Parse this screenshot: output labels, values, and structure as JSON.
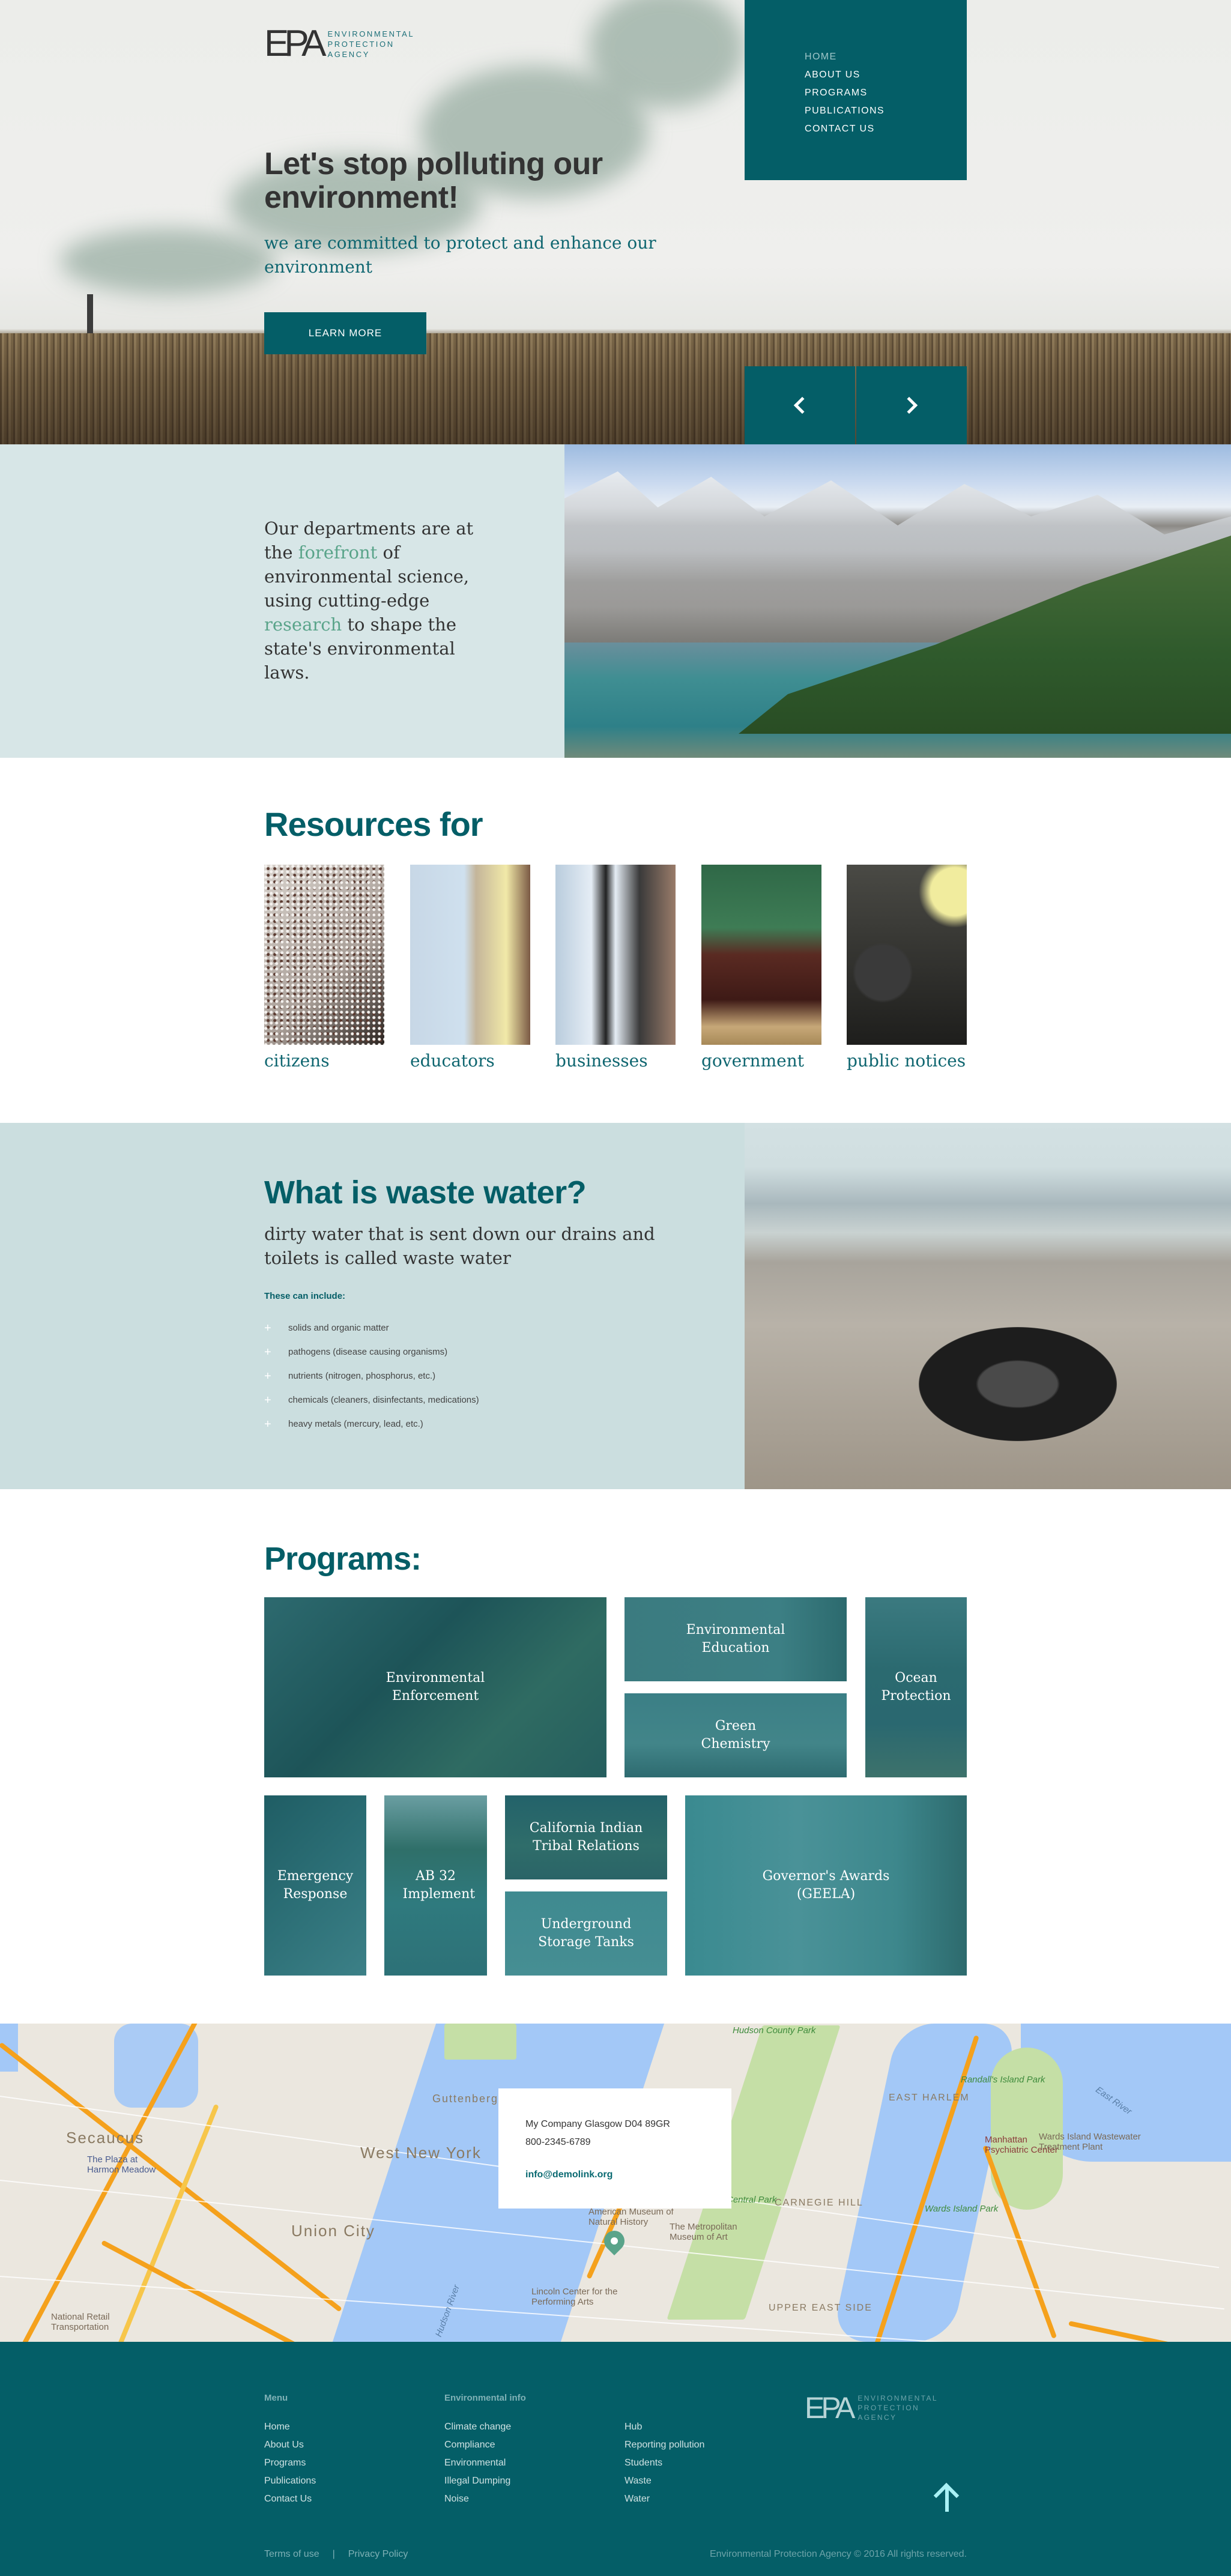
{
  "brand": {
    "mark": "EPA",
    "words": [
      "ENVIRONMENTAL",
      "PROTECTION",
      "AGENCY"
    ]
  },
  "nav": {
    "items": [
      {
        "label": "HOME",
        "active": true
      },
      {
        "label": "ABOUT US",
        "active": false
      },
      {
        "label": "PROGRAMS",
        "active": false
      },
      {
        "label": "PUBLICATIONS",
        "active": false
      },
      {
        "label": "CONTACT US",
        "active": false
      }
    ]
  },
  "hero": {
    "title": "Let's stop polluting our environment!",
    "subtitle": "we are committed to protect and enhance our environment",
    "cta_label": "LEARN MORE",
    "prev_icon": "chevron-left-icon",
    "next_icon": "chevron-right-icon"
  },
  "about": {
    "parts": [
      {
        "text": "Our departments are at the ",
        "highlight": false
      },
      {
        "text": "forefront",
        "highlight": true
      },
      {
        "text": " of environmental science, using cutting-edge ",
        "highlight": false
      },
      {
        "text": "research",
        "highlight": true
      },
      {
        "text": " to shape the state's environmental laws.",
        "highlight": false
      }
    ],
    "highlight_color": "#5aa48a"
  },
  "resources": {
    "title": "Resources for",
    "items": [
      {
        "label": "citizens"
      },
      {
        "label": "educators"
      },
      {
        "label": "businesses"
      },
      {
        "label": "government"
      },
      {
        "label": "public notices"
      }
    ]
  },
  "waste_water": {
    "title": "What is waste water?",
    "subtitle": "dirty water that is sent down our drains and toilets is called waste water",
    "list_heading": "These can include:",
    "bullet": "+",
    "items": [
      "solids and organic matter",
      "pathogens (disease causing organisms)",
      "nutrients (nitrogen, phosphorus, etc.)",
      "chemicals (cleaners, disinfectants, medications)",
      "heavy metals (mercury, lead, etc.)"
    ]
  },
  "programs": {
    "title": "Programs:",
    "items": [
      {
        "label": "Environmental Enforcement"
      },
      {
        "label": "Environmental Education"
      },
      {
        "label": "Green Chemistry"
      },
      {
        "label": "Ocean Protection"
      },
      {
        "label": "Emergency Response"
      },
      {
        "label": "AB 32 Implement"
      },
      {
        "label": "California Indian Tribal Relations"
      },
      {
        "label": "Underground Storage Tanks"
      },
      {
        "label": "Governor's Awards (GEELA)"
      }
    ]
  },
  "map": {
    "address": "My Company Glasgow D04 89GR",
    "phone": "800-2345-6789",
    "email": "info@demolink.org",
    "labels": {
      "secaucus": "Secaucus",
      "west_new_york": "West New York",
      "union_city": "Union City",
      "guttenberg": "Guttenberg",
      "east_harlem": "EAST HARLEM",
      "carnegie_hill": "CARNEGIE HILL",
      "upper_east_side": "UPPER EAST SIDE",
      "central_park": "Central Park",
      "randalls_island": "Randall's Island Park",
      "wards_island": "Wards Island Park",
      "east_river": "East River",
      "hudson_river": "Hudson River",
      "amnh": "American Museum of Natural History",
      "met": "The Metropolitan Museum of Art",
      "lincoln": "Lincoln Center for the Performing Arts",
      "plaza": "The Plaza at Harmon Meadow",
      "psych": "Manhattan Psychiatric Center",
      "wastewater": "Wards Island Wastewater Treatment Plant",
      "nrt": "National Retail Transportation",
      "hudson_county_park": "Hudson County Park"
    }
  },
  "footer": {
    "menu_heading": "Menu",
    "menu": [
      "Home",
      "About Us",
      "Programs",
      "Publications",
      "Contact Us"
    ],
    "env_heading": "Environmental info",
    "env_col1": [
      "Climate change",
      "Compliance",
      "Environmental",
      "Illegal Dumping",
      "Noise"
    ],
    "env_col2": [
      "Hub",
      "Reporting pollution",
      "Students",
      "Waste",
      "Water"
    ],
    "terms": "Terms of use",
    "separator": "|",
    "privacy": "Privacy Policy",
    "copyright": "Environmental Protection Agency © 2016 All rights reserved.",
    "back_to_top_icon": "arrow-up-icon"
  },
  "colors": {
    "primary": "#045e67",
    "light_band": "#d7e6e7",
    "waste_band": "#cbdedf",
    "accent_green": "#5aa48a",
    "footer_heading": "#7fb1b6"
  }
}
